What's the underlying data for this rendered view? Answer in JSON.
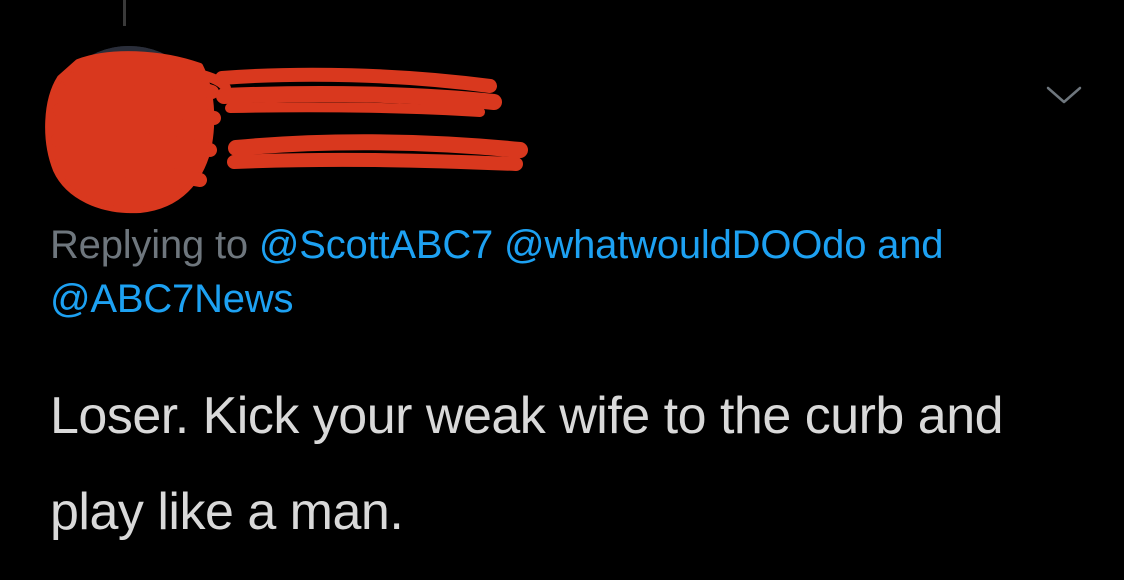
{
  "author": {
    "avatar": "redacted-avatar",
    "display_name": "",
    "handle": "",
    "redaction_color": "#d9381e"
  },
  "menu": {
    "icon": "chevron-down-icon"
  },
  "reply": {
    "prefix": "Replying to",
    "mentions": [
      "@ScottABC7",
      "@whatwouldDOOdo",
      "@ABC7News"
    ],
    "conjunction": "and"
  },
  "tweet": {
    "text": "Loser. Kick your weak wife to the curb and play like a man."
  },
  "colors": {
    "background": "#000000",
    "muted_text": "#6e767d",
    "link": "#1da1f2",
    "body_text": "#d9d9d9"
  }
}
